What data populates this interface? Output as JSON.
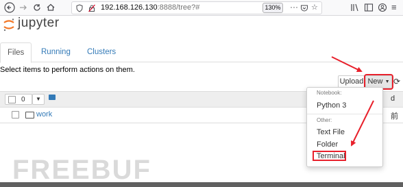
{
  "browser": {
    "url_host": "192.168.126.130",
    "url_rest": ":8888/tree?#",
    "zoom": "130%"
  },
  "header": {
    "logo_text": "jupyter"
  },
  "tabs": [
    {
      "label": "Files"
    },
    {
      "label": "Running"
    },
    {
      "label": "Clusters"
    }
  ],
  "instructions": "Select items to perform actions on them.",
  "toolbar": {
    "upload_label": "Upload",
    "new_label": "New"
  },
  "list": {
    "selected_count": "0",
    "rows": [
      {
        "name": "work"
      }
    ],
    "right_peek": [
      "d",
      "前"
    ]
  },
  "new_menu": {
    "header_notebook": "Notebook:",
    "python": "Python 3",
    "header_other": "Other:",
    "text_file": "Text File",
    "folder": "Folder",
    "terminal": "Terminal"
  },
  "watermark": "FREEBUF",
  "colors": {
    "link": "#337ab7",
    "annotation_red": "#e8202b",
    "logo_orange": "#f37726"
  }
}
